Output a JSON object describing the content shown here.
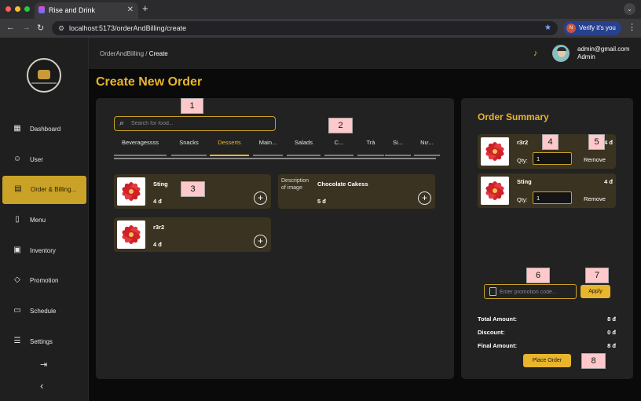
{
  "browser": {
    "tab_title": "Rise and Drink",
    "url": "localhost:5173/orderAndBilling/create",
    "verify_label": "Verify it's you",
    "verify_avatar_letter": "N"
  },
  "topbar": {
    "crumb_parent": "OrderAndBilling",
    "crumb_sep": "/",
    "crumb_current": "Create",
    "user_email": "admin@gmail.com",
    "user_role": "Admin"
  },
  "sidebar": {
    "items": [
      {
        "label": "Dashboard",
        "icon": "dashboard-icon"
      },
      {
        "label": "User",
        "icon": "user-icon"
      },
      {
        "label": "Order & Billing...",
        "icon": "receipt-icon"
      },
      {
        "label": "Menu",
        "icon": "book-icon"
      },
      {
        "label": "Inventory",
        "icon": "box-icon"
      },
      {
        "label": "Promotion",
        "icon": "tag-icon"
      },
      {
        "label": "Schedule",
        "icon": "calendar-icon"
      },
      {
        "label": "Settings",
        "icon": "sliders-icon"
      }
    ],
    "active_index": 2
  },
  "page": {
    "title": "Create New Order"
  },
  "menu_panel": {
    "search_placeholder": "Search for food...",
    "categories": [
      "Beveragessss",
      "Snacks",
      "Desserts",
      "Main...",
      "Salads",
      "C...",
      "Trà",
      "Si...",
      "Nư..."
    ],
    "active_category": "Desserts",
    "items": [
      {
        "name": "Sting",
        "price": "4 đ"
      },
      {
        "name": "Chocolate Cakess",
        "price": "5 đ",
        "alt": "Description of image"
      },
      {
        "name": "r3r2",
        "price": "4 đ"
      }
    ]
  },
  "summary": {
    "title": "Order Summary",
    "qty_label": "Qty:",
    "remove_label": "Remove",
    "items": [
      {
        "name": "r3r2",
        "amount": "4 đ",
        "qty": "1"
      },
      {
        "name": "Sting",
        "amount": "4 đ",
        "qty": "1"
      }
    ],
    "promo_placeholder": "Enter promotion code...",
    "apply_label": "Apply",
    "total_label": "Total Amount:",
    "total_value": "8 đ",
    "discount_label": "Discount:",
    "discount_value": "0 đ",
    "final_label": "Final Amount:",
    "final_value": "8 đ",
    "place_order_label": "Place Order"
  },
  "markers": [
    "1",
    "2",
    "3",
    "4",
    "5",
    "6",
    "7",
    "8"
  ],
  "colors": {
    "accent": "#e8b52c",
    "card_bg": "#3a3321",
    "panel_bg": "#222222",
    "marker_bg": "#ffc9cc"
  }
}
